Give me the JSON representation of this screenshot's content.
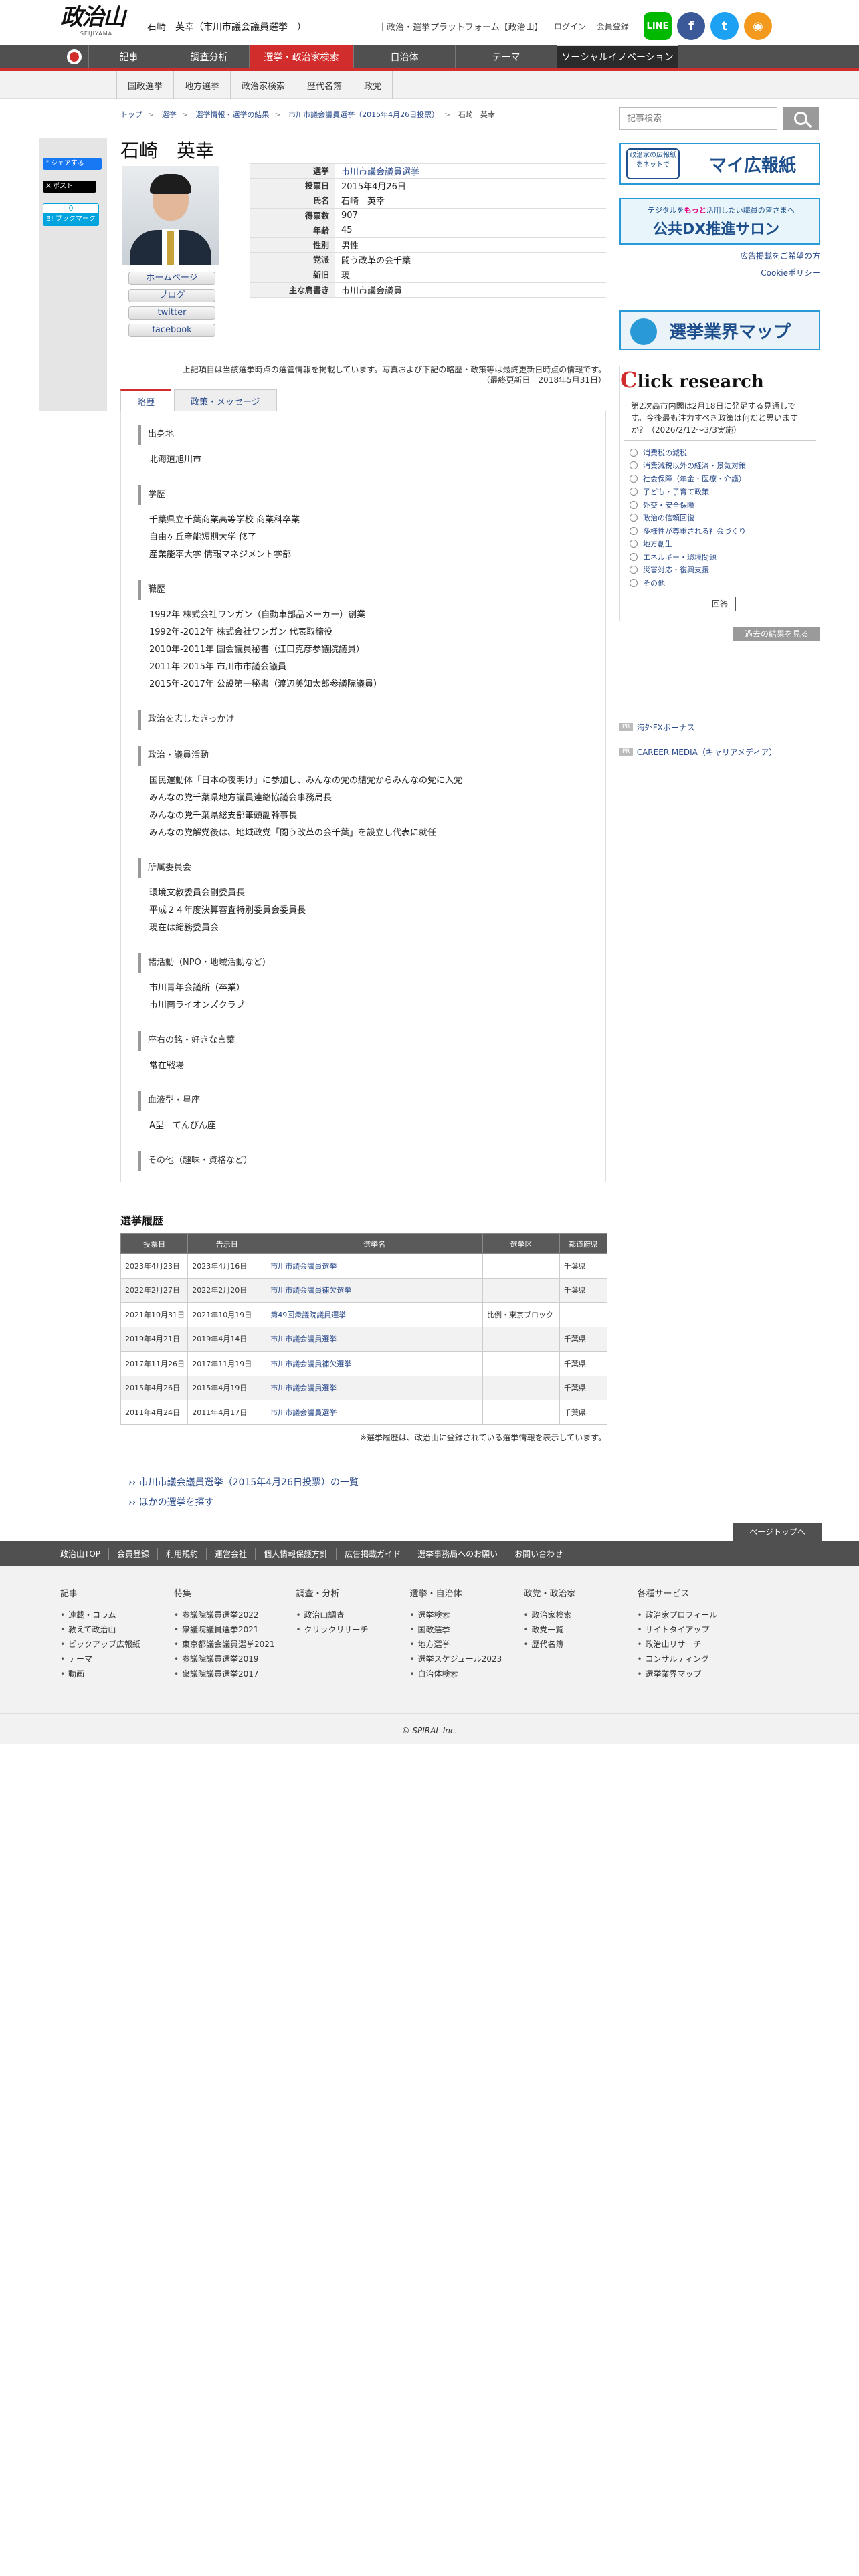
{
  "header": {
    "logo": "政治山",
    "logo_sub": "SEIJIYAMA",
    "title": "石崎　英幸（市川市議会議員選挙　）",
    "tagline": "｜政治・選挙プラットフォーム【政治山】",
    "login": "ログイン",
    "register": "会員登録",
    "social": {
      "line": "LINE",
      "fb": "f",
      "tw": "t",
      "rss": "◉"
    }
  },
  "nav": {
    "items": [
      "記事",
      "調査分析",
      "選挙・政治家検索",
      "自治体",
      "テーマ",
      "ソーシャルイノベーション"
    ],
    "sub": [
      "国政選挙",
      "地方選挙",
      "政治家検索",
      "歴代名簿",
      "政党"
    ]
  },
  "share": {
    "fb": "f シェアする",
    "tw": "X ポスト",
    "hatena_count": "0",
    "hatena": "B! ブックマーク"
  },
  "breadcrumb": [
    "トップ",
    "選挙",
    "選挙情報・選挙の結果",
    "市川市議会議員選挙（2015年4月26日投票）",
    "石崎　英幸"
  ],
  "profile": {
    "name": "石崎　英幸",
    "links": [
      "ホームページ",
      "ブログ",
      "twitter",
      "facebook"
    ],
    "rows": [
      {
        "label": "選挙",
        "value": "市川市議会議員選挙",
        "link": true
      },
      {
        "label": "投票日",
        "value": "2015年4月26日"
      },
      {
        "label": "氏名",
        "value": "石崎　英幸"
      },
      {
        "label": "得票数",
        "value": "907"
      },
      {
        "label": "年齢",
        "value": "45"
      },
      {
        "label": "性別",
        "value": "男性"
      },
      {
        "label": "党派",
        "value": "闘う改革の会千葉"
      },
      {
        "label": "新旧",
        "value": "現"
      },
      {
        "label": "主な肩書き",
        "value": "市川市議会議員"
      }
    ],
    "notes": "上記項目は当該選挙時点の選管情報を掲載しています。写真および下記の略歴・政策等は最終更新日時点の情報です。",
    "updated": "（最終更新日　2018年5月31日）"
  },
  "tabs": [
    "略歴",
    "政策・メッセージ"
  ],
  "bio": [
    {
      "title": "出身地",
      "lines": [
        "北海道旭川市"
      ]
    },
    {
      "title": "学歴",
      "lines": [
        "千葉県立千葉商業高等学校 商業科卒業",
        "自由ヶ丘産能短期大学 修了",
        "産業能率大学 情報マネジメント学部"
      ]
    },
    {
      "title": "職歴",
      "lines": [
        "1992年 株式会社ワンガン（自動車部品メーカー）創業",
        "1992年-2012年 株式会社ワンガン 代表取締役",
        "2010年-2011年 国会議員秘書（江口克彦参議院議員）",
        "2011年-2015年 市川市市議会議員",
        "2015年-2017年 公設第一秘書（渡辺美知太郎参議院議員）"
      ]
    },
    {
      "title": "政治を志したきっかけ",
      "lines": []
    },
    {
      "title": "政治・議員活動",
      "lines": [
        "国民運動体「日本の夜明け」に参加し、みんなの党の結党からみんなの党に入党",
        "みんなの党千葉県地方議員連絡協議会事務局長",
        "みんなの党千葉県総支部筆頭副幹事長",
        "みんなの党解党後は、地域政党「闘う改革の会千葉」を設立し代表に就任"
      ]
    },
    {
      "title": "所属委員会",
      "lines": [
        "環境文教委員会副委員長",
        "平成２４年度決算審査特別委員会委員長",
        "現在は総務委員会"
      ]
    },
    {
      "title": "諸活動（NPO・地域活動など）",
      "lines": [
        "市川青年会議所（卒業）",
        "市川南ライオンズクラブ"
      ]
    },
    {
      "title": "座右の銘・好きな言葉",
      "lines": [
        "常在戦場"
      ]
    },
    {
      "title": "血液型・星座",
      "lines": [
        "A型　てんびん座"
      ]
    },
    {
      "title": "その他（趣味・資格など）",
      "lines": []
    }
  ],
  "history": {
    "heading": "選挙履歴",
    "columns": [
      "投票日",
      "告示日",
      "選挙名",
      "選挙区",
      "都道府県"
    ],
    "rows": [
      [
        "2023年4月23日",
        "2023年4月16日",
        "市川市議会議員選挙",
        "",
        "千葉県"
      ],
      [
        "2022年2月27日",
        "2022年2月20日",
        "市川市議会議員補欠選挙",
        "",
        "千葉県"
      ],
      [
        "2021年10月31日",
        "2021年10月19日",
        "第49回衆議院議員選挙",
        "比例・東京ブロック",
        ""
      ],
      [
        "2019年4月21日",
        "2019年4月14日",
        "市川市議会議員選挙",
        "",
        "千葉県"
      ],
      [
        "2017年11月26日",
        "2017年11月19日",
        "市川市議会議員補欠選挙",
        "",
        "千葉県"
      ],
      [
        "2015年4月26日",
        "2015年4月19日",
        "市川市議会議員選挙",
        "",
        "千葉県"
      ],
      [
        "2011年4月24日",
        "2011年4月17日",
        "市川市議会議員選挙",
        "",
        "千葉県"
      ]
    ],
    "note": "※選挙履歴は、政治山に登録されている選挙情報を表示しています。"
  },
  "bottom_links": [
    "›› 市川市議会議員選挙（2015年4月26日投票）の一覧",
    "›› ほかの選挙を探す"
  ],
  "sidebar": {
    "search_placeholder": "記事検索",
    "banner1_badge": "政治家の広報紙をネットで",
    "banner1": "マイ広報紙",
    "banner2_sub_a": "デジタルを",
    "banner2_sub_b": "もっと",
    "banner2_sub_c": "活用したい職員の皆さまへ",
    "banner2": "公共DX推進サロン",
    "ad_link": "広告掲載をご希望の方",
    "cookie_link": "Cookieポリシー",
    "banner3": "選挙業界マップ",
    "research": {
      "title_c": "C",
      "title_rest": "lick research",
      "question": "第2次高市内閣は2月18日に発足する見通しです。今後最も注力すべき政策は何だと思いますか？（2026/2/12～3/3実施）",
      "options": [
        "消費税の減税",
        "消費減税以外の経済・景気対策",
        "社会保障（年金・医療・介護）",
        "子ども・子育て政策",
        "外交・安全保障",
        "政治の信頼回復",
        "多様性が尊重される社会づくり",
        "地方創生",
        "エネルギー・環境問題",
        "災害対応・復興支援",
        "その他"
      ],
      "submit": "回答",
      "past": "過去の結果を見る"
    },
    "pr_tag": "PR",
    "pr_links": [
      "海外FXボーナス",
      "CAREER MEDIA（キャリアメディア）"
    ]
  },
  "footer": {
    "pagetop": "ページトップへ",
    "nav": [
      "政治山TOP",
      "会員登録",
      "利用規約",
      "運営会社",
      "個人情報保護方針",
      "広告掲載ガイド",
      "選挙事務局へのお願い",
      "お問い合わせ"
    ],
    "columns": [
      {
        "title": "記事",
        "items": [
          "連載・コラム",
          "教えて政治山",
          "ピックアップ広報紙",
          "テーマ",
          "動画"
        ]
      },
      {
        "title": "特集",
        "items": [
          "参議院議員選挙2022",
          "衆議院議員選挙2021",
          "東京都議会議員選挙2021",
          "参議院議員選挙2019",
          "衆議院議員選挙2017"
        ]
      },
      {
        "title": "調査・分析",
        "items": [
          "政治山調査",
          "クリックリサーチ"
        ]
      },
      {
        "title": "選挙・自治体",
        "items": [
          "選挙検索",
          "国政選挙",
          "地方選挙",
          "選挙スケジュール2023",
          "自治体検索"
        ]
      },
      {
        "title": "政党・政治家",
        "items": [
          "政治家検索",
          "政党一覧",
          "歴代名簿"
        ]
      },
      {
        "title": "各種サービス",
        "items": [
          "政治家プロフィール",
          "サイトタイアップ",
          "政治山リサーチ",
          "コンサルティング",
          "選挙業界マップ"
        ]
      }
    ],
    "copyright": "© SPIRAL Inc."
  }
}
